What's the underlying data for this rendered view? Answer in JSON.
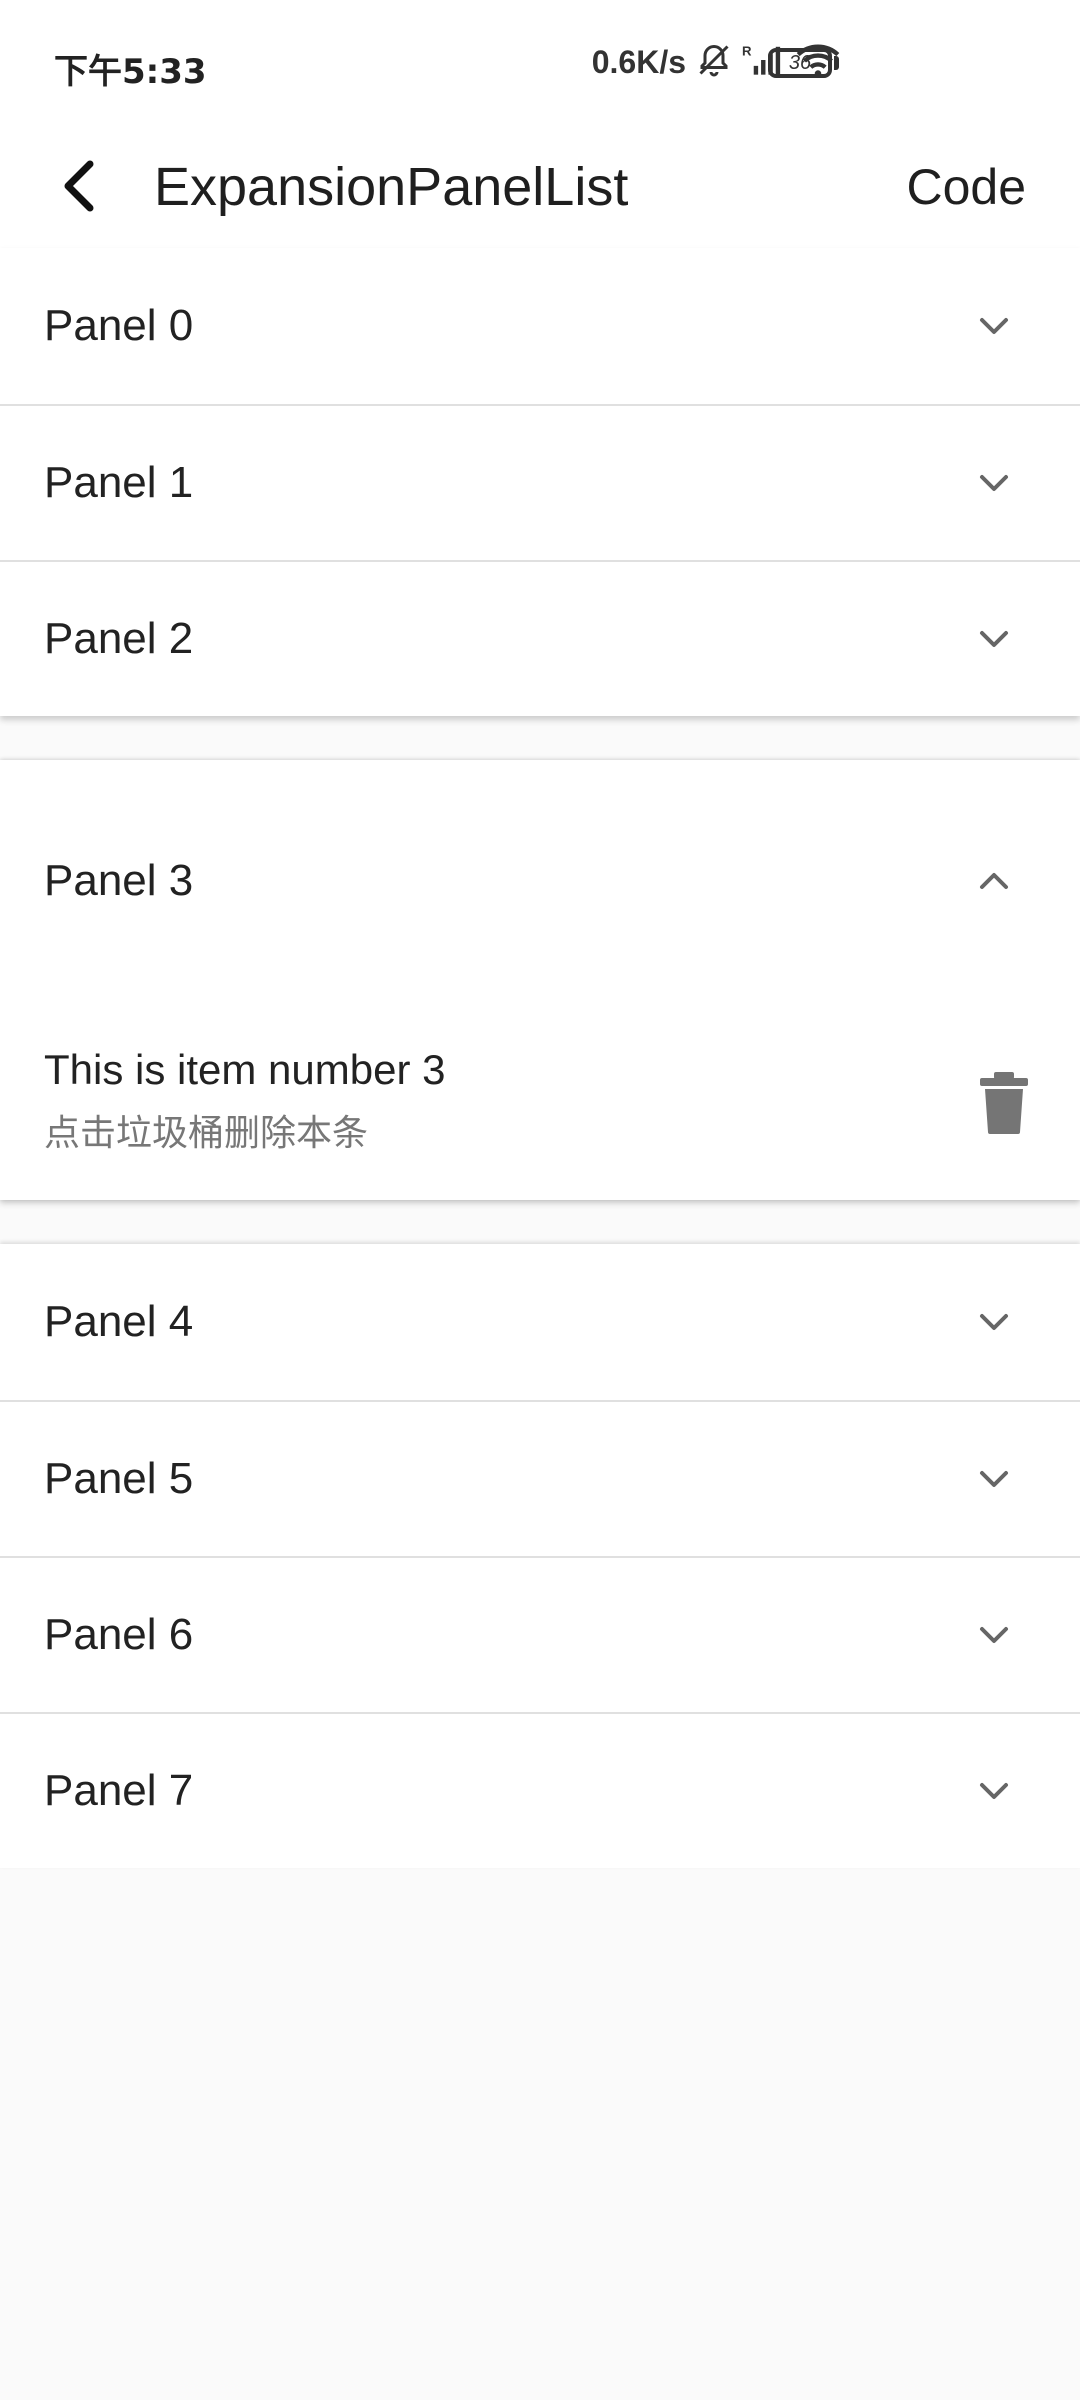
{
  "status_bar": {
    "time": "下午5:33",
    "net_speed": "0.6K/s",
    "battery_level": "36",
    "icons": [
      "mute-bell-icon",
      "signal-icon",
      "wifi-icon",
      "battery-icon"
    ]
  },
  "app_bar": {
    "title": "ExpansionPanelList",
    "action_label": "Code",
    "back_icon": "back-arrow-icon"
  },
  "panels_before": [
    {
      "label": "Panel 0",
      "expanded": false
    },
    {
      "label": "Panel 1",
      "expanded": false
    },
    {
      "label": "Panel 2",
      "expanded": false
    }
  ],
  "expanded_panel": {
    "label": "Panel 3",
    "expanded": true,
    "item_title": "This is item number 3",
    "item_subtitle": "点击垃圾桶删除本条",
    "action_icon": "trash-icon"
  },
  "panels_after": [
    {
      "label": "Panel 4",
      "expanded": false
    },
    {
      "label": "Panel 5",
      "expanded": false
    },
    {
      "label": "Panel 6",
      "expanded": false
    },
    {
      "label": "Panel 7",
      "expanded": false
    }
  ],
  "colors": {
    "background": "#fafafa",
    "surface": "#ffffff",
    "text_primary": "#222222",
    "text_secondary": "#777777",
    "icon": "#666666",
    "divider": "#e0e0e0"
  }
}
